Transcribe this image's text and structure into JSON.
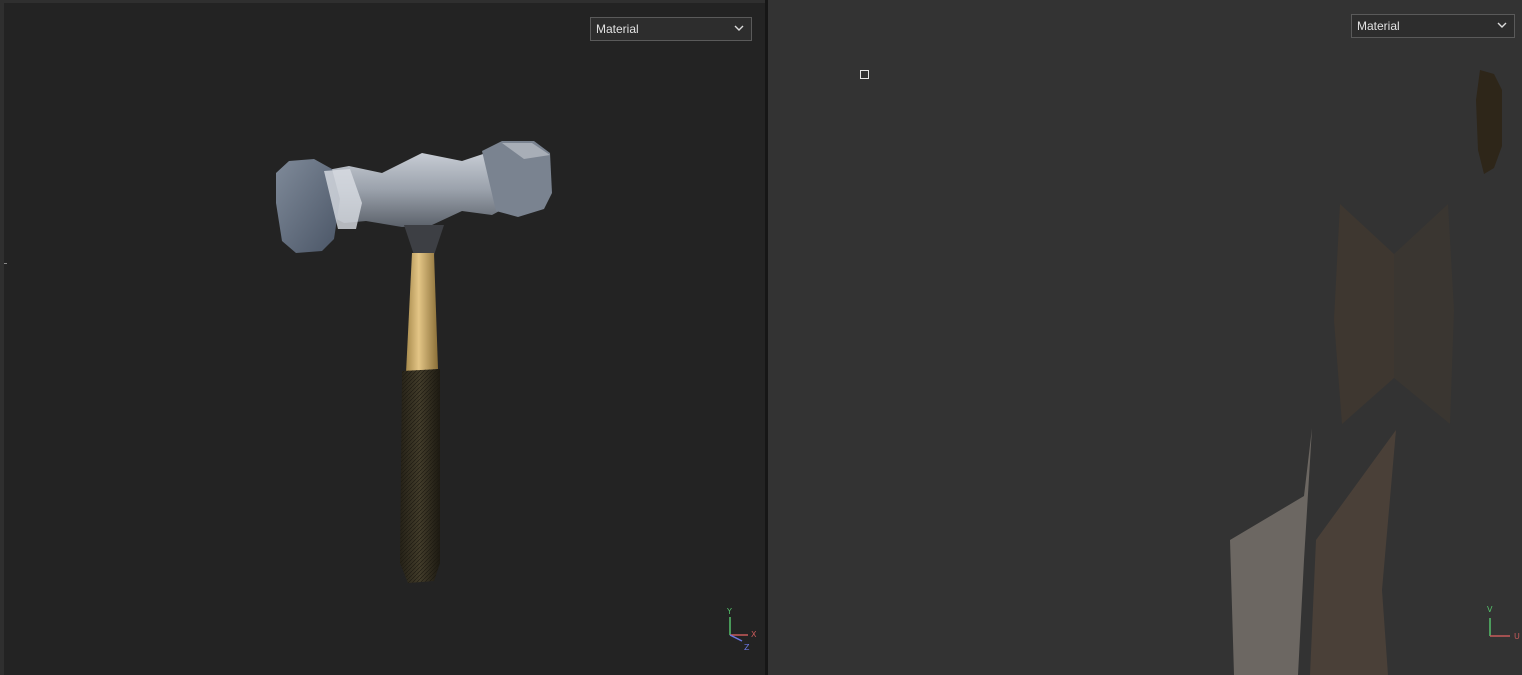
{
  "viewport_3d": {
    "shading_mode": "Material",
    "gizmo": {
      "y": "Y",
      "x": "X",
      "z": "Z"
    }
  },
  "viewport_uv": {
    "shading_mode": "Material",
    "gizmo": {
      "v": "V",
      "u": "U"
    }
  },
  "icons": {
    "dropdown": "chevron-down-icon",
    "uv_cursor": "square-marker-icon"
  }
}
